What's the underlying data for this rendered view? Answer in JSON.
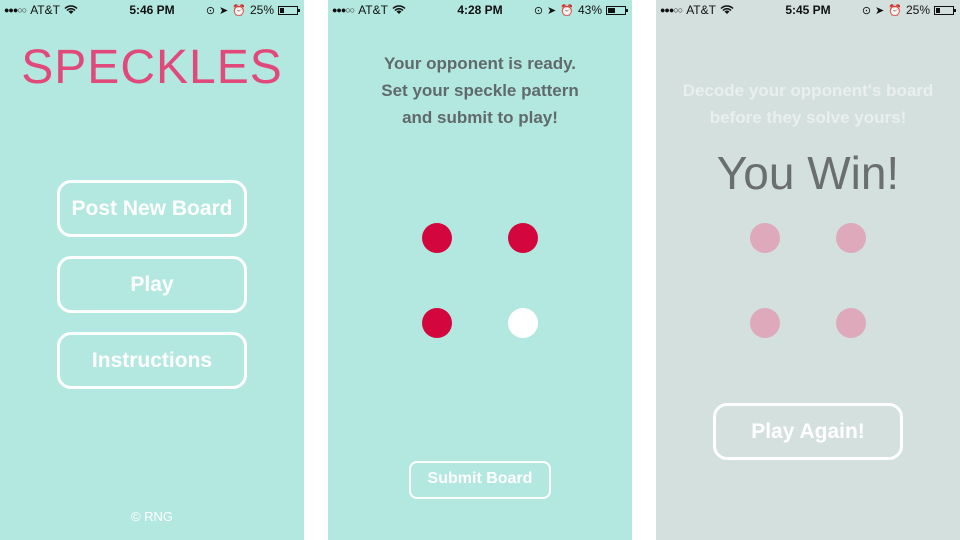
{
  "screens": [
    {
      "status": {
        "carrier": "AT&T",
        "time": "5:46 PM",
        "battery": "25%",
        "battery_fraction": 0.25
      },
      "logo": "SPECKLES",
      "buttons": {
        "post": "Post New Board",
        "play": "Play",
        "instructions": "Instructions"
      },
      "copyright": "© RNG"
    },
    {
      "status": {
        "carrier": "AT&T",
        "time": "4:28 PM",
        "battery": "43%",
        "battery_fraction": 0.43
      },
      "message": [
        "Your opponent is ready.",
        "Set your speckle pattern",
        "and submit to play!"
      ],
      "speckles": [
        {
          "position": "top-left",
          "color": "#d3073d"
        },
        {
          "position": "top-right",
          "color": "#d3073d"
        },
        {
          "position": "bottom-left",
          "color": "#d3073d"
        },
        {
          "position": "bottom-right",
          "color": "#ffffff"
        }
      ],
      "submit_label": "Submit Board"
    },
    {
      "status": {
        "carrier": "AT&T",
        "time": "5:45 PM",
        "battery": "25%",
        "battery_fraction": 0.25
      },
      "message": [
        "Decode your opponent's board",
        "before they solve yours!"
      ],
      "result": "You Win!",
      "speckles": [
        {
          "position": "top-left",
          "color": "#dda9bb"
        },
        {
          "position": "top-right",
          "color": "#dda9bb"
        },
        {
          "position": "bottom-left",
          "color": "#dda9bb"
        },
        {
          "position": "bottom-right",
          "color": "#dda9bb"
        }
      ],
      "play_again_label": "Play Again!"
    }
  ],
  "colors": {
    "mint_background": "#b3e8e0",
    "faded_background": "#d4e0de",
    "logo_pink": "#e0497a",
    "speckle_red": "#d3073d"
  }
}
